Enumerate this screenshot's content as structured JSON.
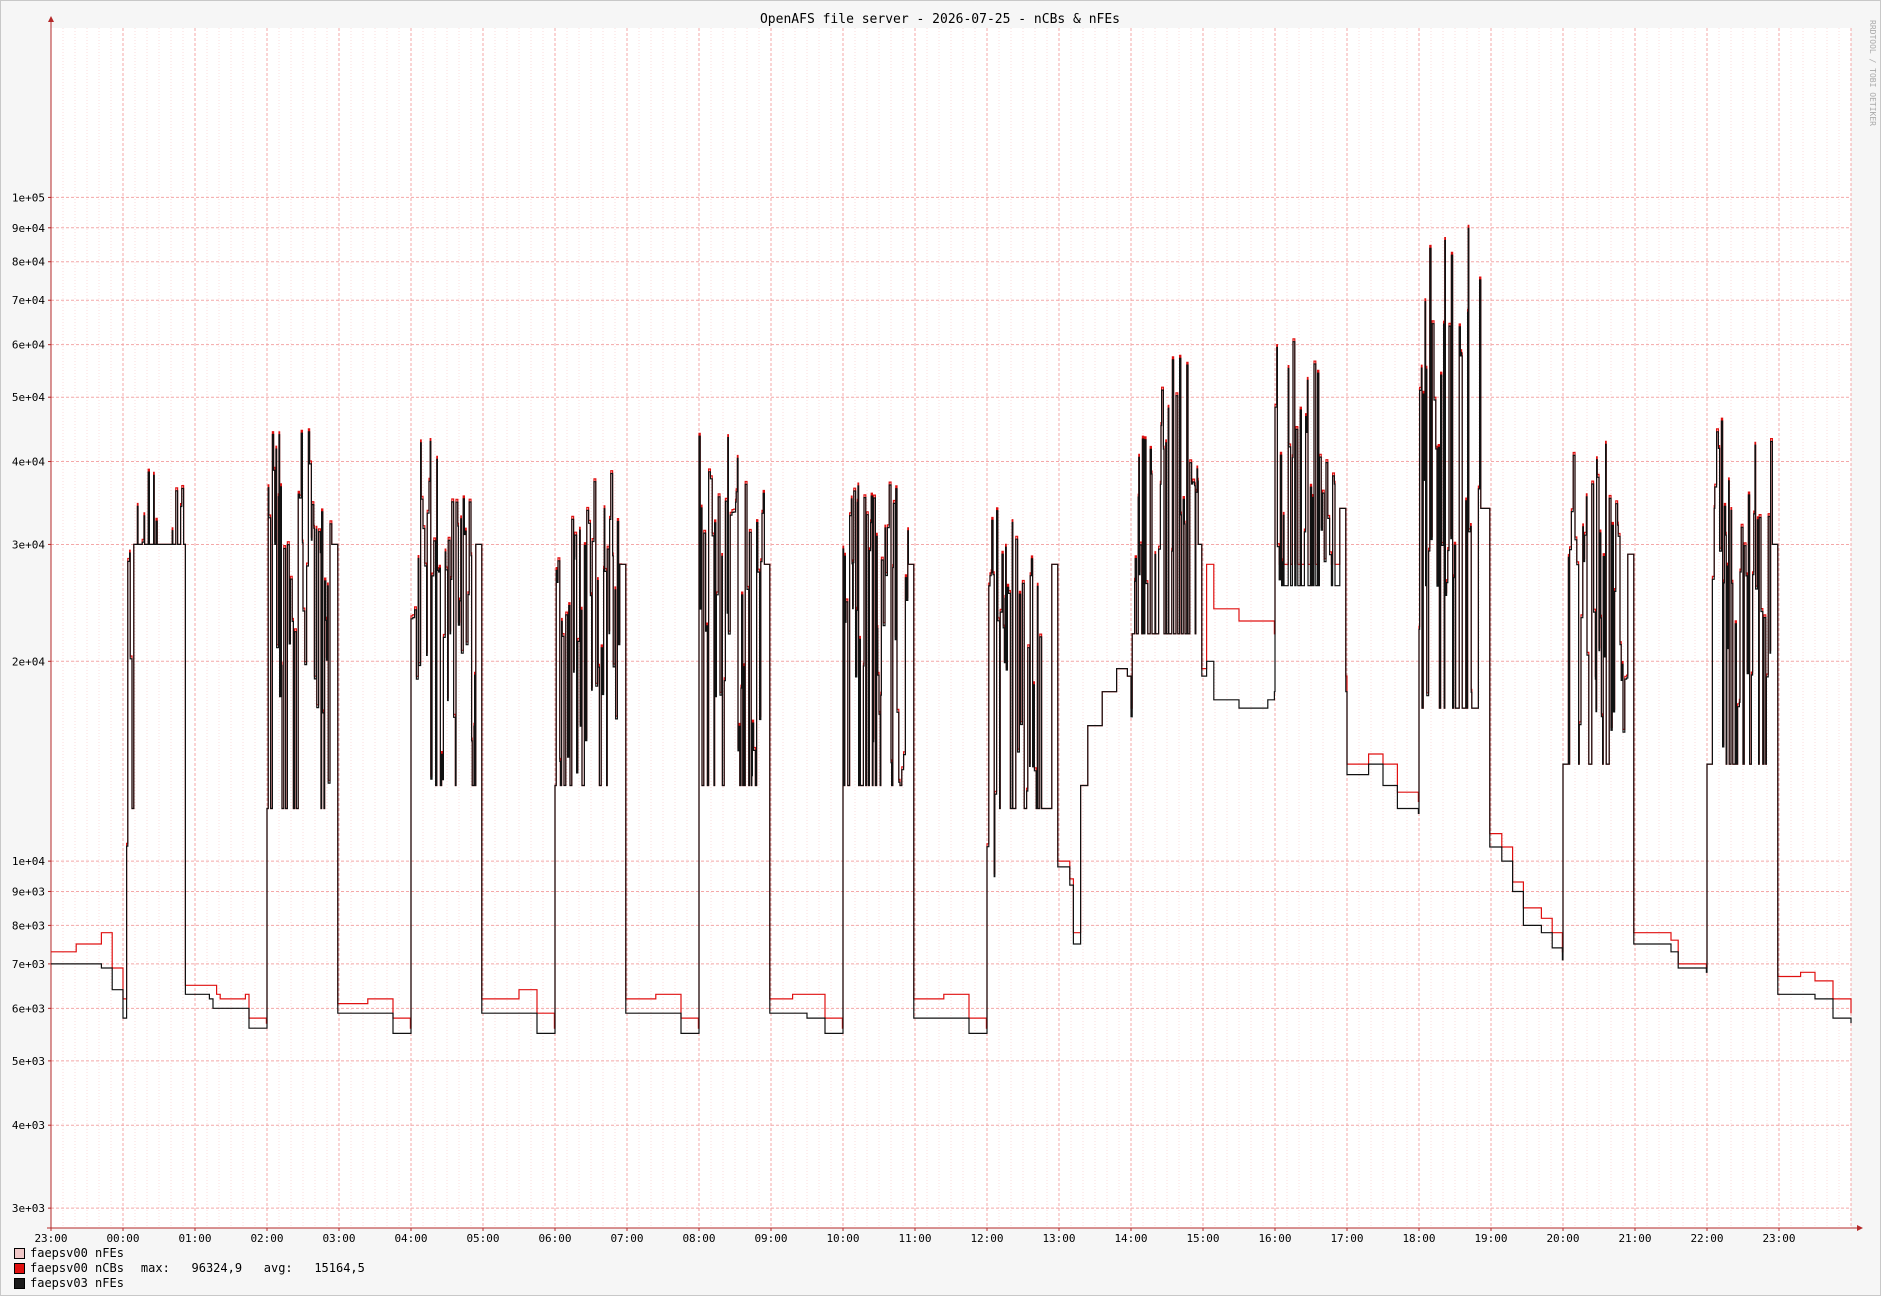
{
  "chart_data": {
    "type": "line",
    "title": "OpenAFS file server - 2026-07-25 - nCBs & nFEs",
    "watermark": "RRDTOOL / TOBI OETIKER",
    "y_scale": "log",
    "ylim": [
      2800,
      180000
    ],
    "xlim": [
      "23:00",
      "24:00"
    ],
    "y_ticks": [
      {
        "value": 3000,
        "label": "3e+03"
      },
      {
        "value": 4000,
        "label": "4e+03"
      },
      {
        "value": 5000,
        "label": "5e+03"
      },
      {
        "value": 6000,
        "label": "6e+03"
      },
      {
        "value": 7000,
        "label": "7e+03"
      },
      {
        "value": 8000,
        "label": "8e+03"
      },
      {
        "value": 9000,
        "label": "9e+03"
      },
      {
        "value": 10000,
        "label": "1e+04"
      },
      {
        "value": 20000,
        "label": "2e+04"
      },
      {
        "value": 30000,
        "label": "3e+04"
      },
      {
        "value": 40000,
        "label": "4e+04"
      },
      {
        "value": 50000,
        "label": "5e+04"
      },
      {
        "value": 60000,
        "label": "6e+04"
      },
      {
        "value": 70000,
        "label": "7e+04"
      },
      {
        "value": 80000,
        "label": "8e+04"
      },
      {
        "value": 90000,
        "label": "9e+04"
      },
      {
        "value": 100000,
        "label": "1e+05"
      }
    ],
    "x_ticks": [
      "23:00",
      "00:00",
      "01:00",
      "02:00",
      "03:00",
      "04:00",
      "05:00",
      "06:00",
      "07:00",
      "08:00",
      "09:00",
      "10:00",
      "11:00",
      "12:00",
      "13:00",
      "14:00",
      "15:00",
      "16:00",
      "17:00",
      "18:00",
      "19:00",
      "20:00",
      "21:00",
      "22:00",
      "23:00"
    ],
    "grid": true,
    "legend_position": "bottom-left",
    "colors": {
      "background": "#f6f6f6",
      "canvas": "#ffffff",
      "major_grid": "#f4a8a8",
      "minor_grid": "#fbdcdc",
      "axis": "#b42828"
    },
    "series": [
      {
        "name": "faepsv00 nFEs",
        "color": "#f0c8c8",
        "stroke": "#f0c8c8",
        "stats": ""
      },
      {
        "name": "faepsv00 nCBs",
        "color": "#e01010",
        "stroke": "#e01010",
        "stats": "max:   96324,9   avg:   15164,5",
        "offset": 1.03,
        "burst_scale": 1.01,
        "key": [
          [
            23.0,
            7300
          ],
          [
            23.35,
            7500
          ],
          [
            23.7,
            7800
          ],
          [
            23.85,
            6900
          ],
          [
            24.0,
            6200
          ],
          [
            24.05,
            6100
          ],
          [
            24.06,
            12000
          ],
          [
            24.15,
            30000
          ],
          [
            24.85,
            30000
          ],
          [
            24.86,
            6500
          ],
          [
            25.1,
            6500
          ],
          [
            25.3,
            6300
          ],
          [
            25.35,
            6200
          ],
          [
            25.7,
            6300
          ],
          [
            25.75,
            5800
          ],
          [
            25.99,
            5700
          ],
          [
            26.0,
            12000
          ],
          [
            26.9,
            30000
          ],
          [
            26.98,
            6100
          ],
          [
            27.4,
            6200
          ],
          [
            27.7,
            6200
          ],
          [
            27.75,
            5800
          ],
          [
            27.99,
            5600
          ],
          [
            28.0,
            13000
          ],
          [
            28.9,
            30000
          ],
          [
            28.98,
            6200
          ],
          [
            29.5,
            6400
          ],
          [
            29.75,
            5900
          ],
          [
            29.99,
            5600
          ],
          [
            30.0,
            13000
          ],
          [
            30.9,
            28000
          ],
          [
            30.98,
            6200
          ],
          [
            31.4,
            6300
          ],
          [
            31.75,
            5800
          ],
          [
            31.99,
            5600
          ],
          [
            32.0,
            13000
          ],
          [
            32.9,
            28000
          ],
          [
            32.98,
            6200
          ],
          [
            33.3,
            6300
          ],
          [
            33.75,
            5800
          ],
          [
            33.99,
            5600
          ],
          [
            34.0,
            13000
          ],
          [
            34.9,
            28000
          ],
          [
            34.98,
            6200
          ],
          [
            35.4,
            6300
          ],
          [
            35.75,
            5800
          ],
          [
            35.99,
            5600
          ],
          [
            36.0,
            8200
          ],
          [
            36.15,
            12000
          ],
          [
            36.9,
            28000
          ],
          [
            36.98,
            10000
          ],
          [
            37.15,
            9400
          ],
          [
            37.2,
            7800
          ],
          [
            37.3,
            13000
          ],
          [
            37.4,
            16000
          ],
          [
            37.6,
            18000
          ],
          [
            37.8,
            19500
          ],
          [
            37.95,
            19000
          ],
          [
            38.0,
            17000
          ],
          [
            38.01,
            22000
          ],
          [
            38.9,
            30000
          ],
          [
            38.98,
            19500
          ],
          [
            39.05,
            28000
          ],
          [
            39.15,
            24000
          ],
          [
            39.5,
            23000
          ],
          [
            39.9,
            23000
          ],
          [
            39.99,
            22000
          ],
          [
            40.0,
            28000
          ],
          [
            40.9,
            34000
          ],
          [
            40.98,
            19000
          ],
          [
            41.0,
            14000
          ],
          [
            41.3,
            14500
          ],
          [
            41.5,
            14000
          ],
          [
            41.7,
            12700
          ],
          [
            41.99,
            12300
          ],
          [
            42.0,
            17000
          ],
          [
            42.85,
            34000
          ],
          [
            42.98,
            11000
          ],
          [
            43.15,
            10500
          ],
          [
            43.3,
            9300
          ],
          [
            43.45,
            8500
          ],
          [
            43.7,
            8200
          ],
          [
            43.85,
            7800
          ],
          [
            43.99,
            7300
          ],
          [
            44.0,
            14000
          ],
          [
            44.9,
            29000
          ],
          [
            44.98,
            7800
          ],
          [
            45.3,
            7800
          ],
          [
            45.5,
            7600
          ],
          [
            45.6,
            7000
          ],
          [
            45.99,
            6900
          ],
          [
            46.0,
            14000
          ],
          [
            46.9,
            30000
          ],
          [
            46.98,
            6700
          ],
          [
            47.3,
            6800
          ],
          [
            47.5,
            6600
          ],
          [
            47.75,
            6200
          ],
          [
            48.0,
            5900
          ]
        ]
      },
      {
        "name": "faepsv03 nFEs",
        "color": "#1a1a1a",
        "stroke": "#111111",
        "stats": "",
        "offset": 1.0,
        "burst_scale": 1.0,
        "key": [
          [
            23.0,
            7000
          ],
          [
            23.35,
            7000
          ],
          [
            23.7,
            6900
          ],
          [
            23.85,
            6400
          ],
          [
            24.0,
            5800
          ],
          [
            24.05,
            5800
          ],
          [
            24.06,
            12000
          ],
          [
            24.15,
            30000
          ],
          [
            24.85,
            30000
          ],
          [
            24.86,
            6300
          ],
          [
            25.2,
            6200
          ],
          [
            25.25,
            6000
          ],
          [
            25.7,
            6000
          ],
          [
            25.75,
            5600
          ],
          [
            25.99,
            5600
          ],
          [
            26.0,
            12000
          ],
          [
            26.9,
            30000
          ],
          [
            26.98,
            5900
          ],
          [
            27.5,
            5900
          ],
          [
            27.75,
            5500
          ],
          [
            27.99,
            5500
          ],
          [
            28.0,
            13000
          ],
          [
            28.9,
            30000
          ],
          [
            28.98,
            5900
          ],
          [
            29.5,
            5900
          ],
          [
            29.75,
            5500
          ],
          [
            29.99,
            5500
          ],
          [
            30.0,
            13000
          ],
          [
            30.9,
            28000
          ],
          [
            30.98,
            5900
          ],
          [
            31.5,
            5900
          ],
          [
            31.75,
            5500
          ],
          [
            31.99,
            5500
          ],
          [
            32.0,
            13000
          ],
          [
            32.9,
            28000
          ],
          [
            32.98,
            5900
          ],
          [
            33.5,
            5800
          ],
          [
            33.75,
            5500
          ],
          [
            33.99,
            5500
          ],
          [
            34.0,
            13000
          ],
          [
            34.9,
            28000
          ],
          [
            34.98,
            5800
          ],
          [
            35.5,
            5800
          ],
          [
            35.75,
            5500
          ],
          [
            35.99,
            5500
          ],
          [
            36.0,
            8000
          ],
          [
            36.15,
            12000
          ],
          [
            36.9,
            28000
          ],
          [
            36.98,
            9800
          ],
          [
            37.15,
            9200
          ],
          [
            37.2,
            7500
          ],
          [
            37.3,
            13000
          ],
          [
            37.4,
            16000
          ],
          [
            37.6,
            18000
          ],
          [
            37.8,
            19500
          ],
          [
            37.95,
            19000
          ],
          [
            38.0,
            16500
          ],
          [
            38.01,
            22000
          ],
          [
            38.9,
            30000
          ],
          [
            38.98,
            19000
          ],
          [
            39.05,
            20000
          ],
          [
            39.15,
            17500
          ],
          [
            39.5,
            17000
          ],
          [
            39.9,
            17500
          ],
          [
            39.99,
            18000
          ],
          [
            40.0,
            26000
          ],
          [
            40.9,
            34000
          ],
          [
            40.98,
            18000
          ],
          [
            41.0,
            13500
          ],
          [
            41.3,
            14000
          ],
          [
            41.5,
            13000
          ],
          [
            41.7,
            12000
          ],
          [
            41.99,
            11800
          ],
          [
            42.0,
            17000
          ],
          [
            42.85,
            34000
          ],
          [
            42.98,
            10500
          ],
          [
            43.15,
            10000
          ],
          [
            43.3,
            9000
          ],
          [
            43.45,
            8000
          ],
          [
            43.7,
            7800
          ],
          [
            43.85,
            7400
          ],
          [
            43.99,
            7100
          ],
          [
            44.0,
            14000
          ],
          [
            44.9,
            29000
          ],
          [
            44.98,
            7500
          ],
          [
            45.3,
            7500
          ],
          [
            45.5,
            7300
          ],
          [
            45.6,
            6900
          ],
          [
            45.99,
            6800
          ],
          [
            46.0,
            14000
          ],
          [
            46.9,
            30000
          ],
          [
            46.98,
            6300
          ],
          [
            47.3,
            6300
          ],
          [
            47.5,
            6200
          ],
          [
            47.75,
            5800
          ],
          [
            48.0,
            5700
          ]
        ]
      }
    ],
    "bursts": [
      {
        "start": 24.05,
        "end": 24.85,
        "max": 44000
      },
      {
        "start": 26.0,
        "end": 26.9,
        "max": 46000
      },
      {
        "start": 28.0,
        "end": 28.9,
        "max": 43000
      },
      {
        "start": 30.0,
        "end": 30.9,
        "max": 39000
      },
      {
        "start": 32.0,
        "end": 32.9,
        "max": 44000
      },
      {
        "start": 34.0,
        "end": 34.9,
        "max": 46000
      },
      {
        "start": 36.0,
        "end": 36.75,
        "max": 41000
      },
      {
        "start": 38.05,
        "end": 38.95,
        "max": 59000
      },
      {
        "start": 40.0,
        "end": 40.85,
        "max": 61000
      },
      {
        "start": 42.0,
        "end": 42.85,
        "max": 96000
      },
      {
        "start": 44.05,
        "end": 44.9,
        "max": 44000
      },
      {
        "start": 46.05,
        "end": 46.9,
        "max": 47000
      }
    ]
  }
}
